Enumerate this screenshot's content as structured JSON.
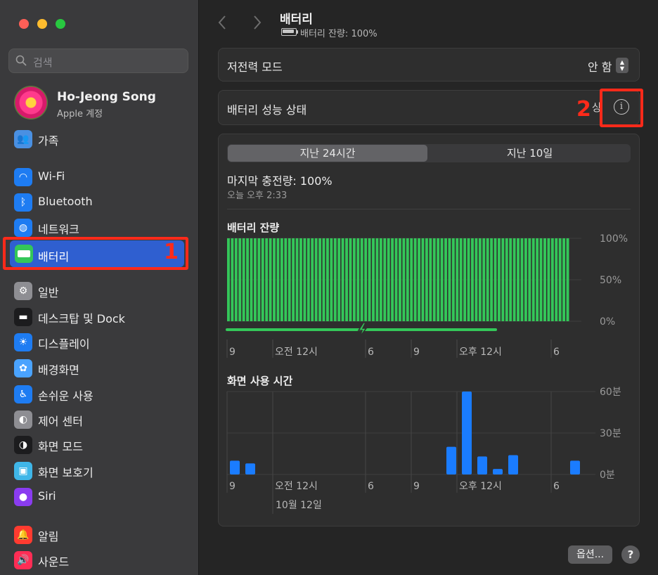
{
  "sidebar": {
    "search_placeholder": "검색",
    "user": {
      "name": "Ho-Jeong Song",
      "subtitle": "Apple 계정"
    },
    "items": [
      {
        "label": "가족",
        "icon": "family-icon",
        "color": "#4a90e2"
      },
      {
        "label": "Wi-Fi",
        "icon": "wifi-icon",
        "color": "#1e7cf2"
      },
      {
        "label": "Bluetooth",
        "icon": "bluetooth-icon",
        "color": "#1e7cf2"
      },
      {
        "label": "네트워크",
        "icon": "network-globe-icon",
        "color": "#1e7cf2"
      },
      {
        "label": "배터리",
        "icon": "battery-icon",
        "color": "#34c759"
      },
      {
        "label": "일반",
        "icon": "gear-icon",
        "color": "#8e8e93"
      },
      {
        "label": "데스크탑 및 Dock",
        "icon": "dock-icon",
        "color": "#1c1c1e"
      },
      {
        "label": "디스플레이",
        "icon": "sun-icon",
        "color": "#1e7cf2"
      },
      {
        "label": "배경화면",
        "icon": "flower-icon",
        "color": "#4aa3ff"
      },
      {
        "label": "손쉬운 사용",
        "icon": "accessibility-icon",
        "color": "#1e7cf2"
      },
      {
        "label": "제어 센터",
        "icon": "toggles-icon",
        "color": "#8e8e93"
      },
      {
        "label": "화면 모드",
        "icon": "appearance-icon",
        "color": "#1c1c1e"
      },
      {
        "label": "화면 보호기",
        "icon": "screensaver-icon",
        "color": "#3fb6e8"
      },
      {
        "label": "Siri",
        "icon": "siri-icon",
        "color": "#8a3cf0"
      },
      {
        "label": "알림",
        "icon": "bell-icon",
        "color": "#ff3b30"
      },
      {
        "label": "사운드",
        "icon": "speaker-icon",
        "color": "#ff2d55"
      }
    ],
    "active_index": 4,
    "annotation": "1"
  },
  "header": {
    "title": "배터리",
    "subtitle": "배터리 잔량: 100%"
  },
  "low_power": {
    "label": "저전력 모드",
    "value": "안 함"
  },
  "health": {
    "label": "배터리 성능 상태",
    "annotation": "2",
    "obscured_text": "상"
  },
  "tabs": [
    {
      "label": "지난 24시간",
      "selected": true
    },
    {
      "label": "지난 10일",
      "selected": false
    }
  ],
  "last_charge": {
    "label": "마지막 충전량: 100%",
    "time": "오늘 오후 2:33"
  },
  "battery_chart": {
    "title": "배터리 잔량",
    "y_ticks": [
      "100%",
      "50%",
      "0%"
    ],
    "x_ticks": [
      "9",
      "오전 12시",
      "6",
      "9",
      "오후 12시",
      "6"
    ]
  },
  "screen_chart": {
    "title": "화면 사용 시간",
    "y_ticks": [
      "60분",
      "30분",
      "0분"
    ],
    "x_ticks": [
      "9",
      "오전 12시",
      "6",
      "9",
      "오후 12시",
      "6"
    ],
    "date_label": "10월 12일"
  },
  "footer": {
    "options_label": "옵션...",
    "help_label": "?"
  },
  "chart_data": [
    {
      "type": "bar",
      "title": "배터리 잔량",
      "ylabel": "",
      "ylim": [
        0,
        100
      ],
      "y_unit": "%",
      "bar_count": 90,
      "values_all": 100,
      "charging_indicator": true,
      "color": "#34c759"
    },
    {
      "type": "bar",
      "title": "화면 사용 시간",
      "ylabel": "",
      "ylim": [
        0,
        60
      ],
      "y_unit": "분",
      "hour_slots": 24,
      "values": [
        10,
        8,
        0,
        0,
        0,
        0,
        0,
        0,
        0,
        0,
        0,
        0,
        0,
        0,
        20,
        60,
        13,
        4,
        14,
        0,
        0,
        0,
        10,
        0
      ],
      "color": "#1a7cff"
    }
  ]
}
